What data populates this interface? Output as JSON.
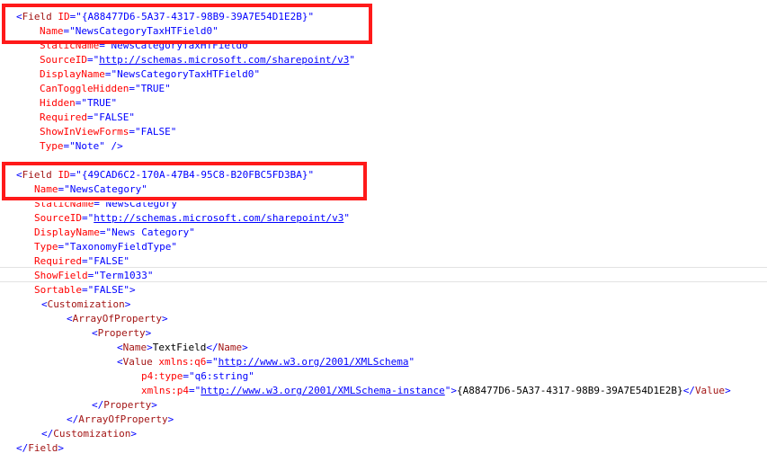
{
  "field1": {
    "open_tag": "Field",
    "id_attr": "ID",
    "id_value": "{A88477D6-5A37-4317-98B9-39A7E54D1E2B}",
    "name_attr": "Name",
    "name_value": "NewsCategoryTaxHTField0",
    "staticname_attr": "StaticName",
    "staticname_value": "NewsCategoryTaxHTField0",
    "sourceid_attr": "SourceID",
    "sourceid_value": "http://schemas.microsoft.com/sharepoint/v3",
    "displayname_attr": "DisplayName",
    "displayname_value": "NewsCategoryTaxHTField0",
    "cantoggle_attr": "CanToggleHidden",
    "cantoggle_value": "TRUE",
    "hidden_attr": "Hidden",
    "hidden_value": "TRUE",
    "required_attr": "Required",
    "required_value": "FALSE",
    "showinview_attr": "ShowInViewForms",
    "showinview_value": "FALSE",
    "type_attr": "Type",
    "type_value": "Note"
  },
  "field2": {
    "open_tag": "Field",
    "id_attr": "ID",
    "id_value": "{49CAD6C2-170A-47B4-95C8-B20FBC5FD3BA}",
    "name_attr": "Name",
    "name_value": "NewsCategory",
    "staticname_attr": "StaticName",
    "staticname_value": "NewsCategory",
    "sourceid_attr": "SourceID",
    "sourceid_value": "http://schemas.microsoft.com/sharepoint/v3",
    "displayname_attr": "DisplayName",
    "displayname_value": "News Category",
    "type_attr": "Type",
    "type_value": "TaxonomyFieldType",
    "required_attr": "Required",
    "required_value": "FALSE",
    "showfield_attr": "ShowField",
    "showfield_value": "Term1033",
    "sortable_attr": "Sortable",
    "sortable_value": "FALSE",
    "customization_tag": "Customization",
    "arrayofproperty_tag": "ArrayOfProperty",
    "property_tag": "Property",
    "name_tag": "Name",
    "name_text": "TextField",
    "value_tag": "Value",
    "xmlns_q6_attr": "xmlns:q6",
    "xmlns_q6_value": "http://www.w3.org/2001/XMLSchema",
    "p4type_attr": "p4:type",
    "p4type_value": "q6:string",
    "xmlns_p4_attr": "xmlns:p4",
    "xmlns_p4_value": "http://www.w3.org/2001/XMLSchema-instance",
    "value_text": "{A88477D6-5A37-4317-98B9-39A7E54D1E2B}",
    "close_customization": "Customization",
    "close_arrayofproperty": "ArrayOfProperty",
    "close_property": "Property",
    "close_field": "Field"
  },
  "colors": {
    "highlight_box": "#ff1a1a",
    "tag": "#a31515",
    "attribute": "#ff0000",
    "value": "#0000ff"
  }
}
